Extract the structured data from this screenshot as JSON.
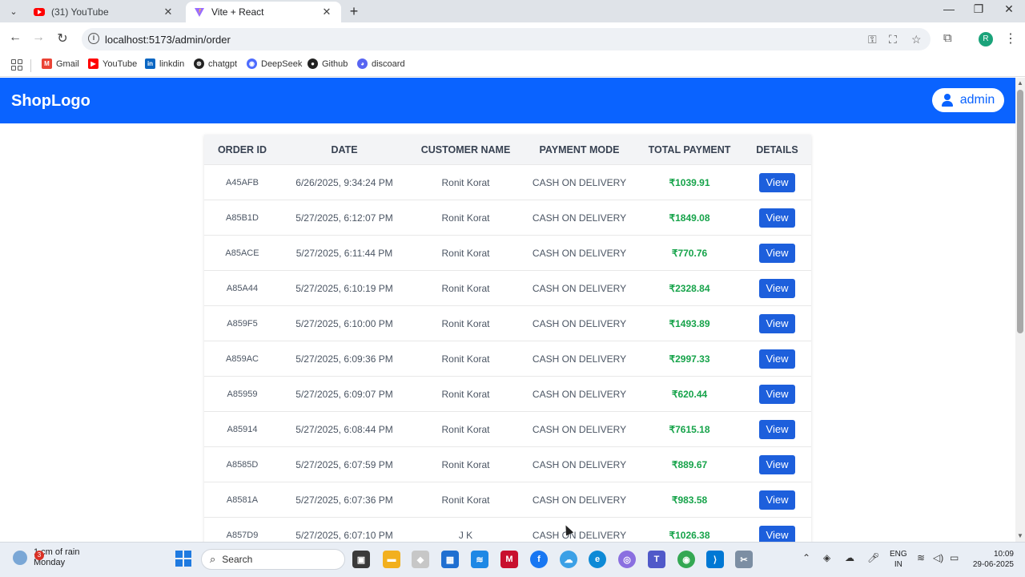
{
  "browser": {
    "tabs": [
      {
        "title": "(31) YouTube",
        "active": false
      },
      {
        "title": "Vite + React",
        "active": true
      }
    ],
    "url": "localhost:5173/admin/order",
    "bookmarks": [
      {
        "label": "Gmail",
        "icon": "gmail-icon"
      },
      {
        "label": "YouTube",
        "icon": "youtube-icon"
      },
      {
        "label": "linkdin",
        "icon": "linkedin-icon"
      },
      {
        "label": "chatgpt",
        "icon": "chatgpt-icon"
      },
      {
        "label": "DeepSeek",
        "icon": "deepseek-icon"
      },
      {
        "label": "Github",
        "icon": "github-icon"
      },
      {
        "label": "discoard",
        "icon": "discord-icon"
      }
    ],
    "profile_initial": "R"
  },
  "app": {
    "logo": "ShopLogo",
    "user_label": "admin",
    "accent": "#0a63ff"
  },
  "table": {
    "headers": [
      "ORDER ID",
      "DATE",
      "CUSTOMER NAME",
      "PAYMENT MODE",
      "TOTAL PAYMENT",
      "DETAILS"
    ],
    "view_label": "View",
    "rows": [
      {
        "id": "A45AFB",
        "date": "6/26/2025, 9:34:24 PM",
        "customer": "Ronit Korat",
        "mode": "CASH ON DELIVERY",
        "total": "₹1039.91"
      },
      {
        "id": "A85B1D",
        "date": "5/27/2025, 6:12:07 PM",
        "customer": "Ronit Korat",
        "mode": "CASH ON DELIVERY",
        "total": "₹1849.08"
      },
      {
        "id": "A85ACE",
        "date": "5/27/2025, 6:11:44 PM",
        "customer": "Ronit Korat",
        "mode": "CASH ON DELIVERY",
        "total": "₹770.76"
      },
      {
        "id": "A85A44",
        "date": "5/27/2025, 6:10:19 PM",
        "customer": "Ronit Korat",
        "mode": "CASH ON DELIVERY",
        "total": "₹2328.84"
      },
      {
        "id": "A859F5",
        "date": "5/27/2025, 6:10:00 PM",
        "customer": "Ronit Korat",
        "mode": "CASH ON DELIVERY",
        "total": "₹1493.89"
      },
      {
        "id": "A859AC",
        "date": "5/27/2025, 6:09:36 PM",
        "customer": "Ronit Korat",
        "mode": "CASH ON DELIVERY",
        "total": "₹2997.33"
      },
      {
        "id": "A85959",
        "date": "5/27/2025, 6:09:07 PM",
        "customer": "Ronit Korat",
        "mode": "CASH ON DELIVERY",
        "total": "₹620.44"
      },
      {
        "id": "A85914",
        "date": "5/27/2025, 6:08:44 PM",
        "customer": "Ronit Korat",
        "mode": "CASH ON DELIVERY",
        "total": "₹7615.18"
      },
      {
        "id": "A8585D",
        "date": "5/27/2025, 6:07:59 PM",
        "customer": "Ronit Korat",
        "mode": "CASH ON DELIVERY",
        "total": "₹889.67"
      },
      {
        "id": "A8581A",
        "date": "5/27/2025, 6:07:36 PM",
        "customer": "Ronit Korat",
        "mode": "CASH ON DELIVERY",
        "total": "₹983.58"
      },
      {
        "id": "A857D9",
        "date": "5/27/2025, 6:07:10 PM",
        "customer": "J K",
        "mode": "CASH ON DELIVERY",
        "total": "₹1026.38"
      }
    ]
  },
  "taskbar": {
    "weather_line1": "1 cm of rain",
    "weather_line2": "Monday",
    "weather_badge": "3",
    "search_placeholder": "Search",
    "lang_line1": "ENG",
    "lang_line2": "IN",
    "time": "10:09",
    "date": "29-06-2025"
  }
}
